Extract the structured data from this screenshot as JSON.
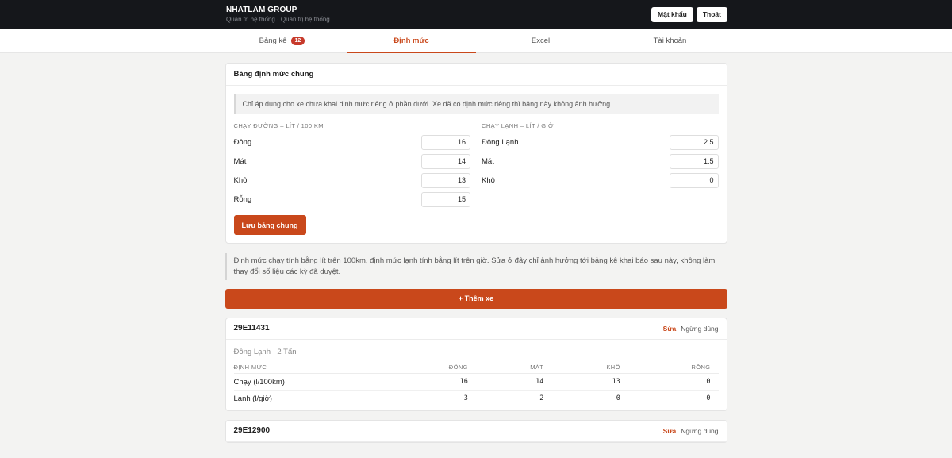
{
  "header": {
    "brand": "NHATLAM GROUP",
    "subtitle": "Quản trị hệ thống · Quản trị hệ thống",
    "password_btn": "Mật khẩu",
    "logout_btn": "Thoát"
  },
  "tabs": [
    {
      "label": "Bảng kê",
      "badge": "12"
    },
    {
      "label": "Định mức"
    },
    {
      "label": "Excel"
    },
    {
      "label": "Tài khoản"
    }
  ],
  "general_norm": {
    "title": "Bảng định mức chung",
    "note": "Chỉ áp dụng cho xe chưa khai định mức riêng ở phần dưới. Xe đã có định mức riêng thì bảng này không ảnh hưởng.",
    "run_head": "CHẠY ĐƯỜNG – LÍT / 100 KM",
    "cold_head": "CHẠY LẠNH – LÍT / GIỜ",
    "run_rows": [
      {
        "label": "Đông",
        "value": "16"
      },
      {
        "label": "Mát",
        "value": "14"
      },
      {
        "label": "Khô",
        "value": "13"
      },
      {
        "label": "Rỗng",
        "value": "15"
      }
    ],
    "cold_rows": [
      {
        "label": "Đông Lạnh",
        "value": "2.5"
      },
      {
        "label": "Mát",
        "value": "1.5"
      },
      {
        "label": "Khô",
        "value": "0"
      }
    ],
    "save_btn": "Lưu bảng chung"
  },
  "info_note": "Định mức chạy tính bằng lít trên 100km, định mức lạnh tính bằng lít trên giờ. Sửa ở đây chỉ ảnh hưởng tới bảng kê khai báo sau này, không làm thay đổi số liệu các kỳ đã duyệt.",
  "add_vehicle_btn": "+ Thêm xe",
  "vehicles": [
    {
      "plate": "29E11431",
      "edit": "Sửa",
      "disable": "Ngừng dùng",
      "meta": "Đông Lạnh · 2 Tấn",
      "columns": [
        "ĐỊNH MỨC",
        "ĐÔNG",
        "MÁT",
        "KHÔ",
        "RỖNG"
      ],
      "rows": [
        [
          "Chạy (l/100km)",
          "16",
          "14",
          "13",
          "0"
        ],
        [
          "Lạnh (l/giờ)",
          "3",
          "2",
          "0",
          "0"
        ]
      ]
    },
    {
      "plate": "29E12900",
      "edit": "Sửa",
      "disable": "Ngừng dùng"
    }
  ]
}
